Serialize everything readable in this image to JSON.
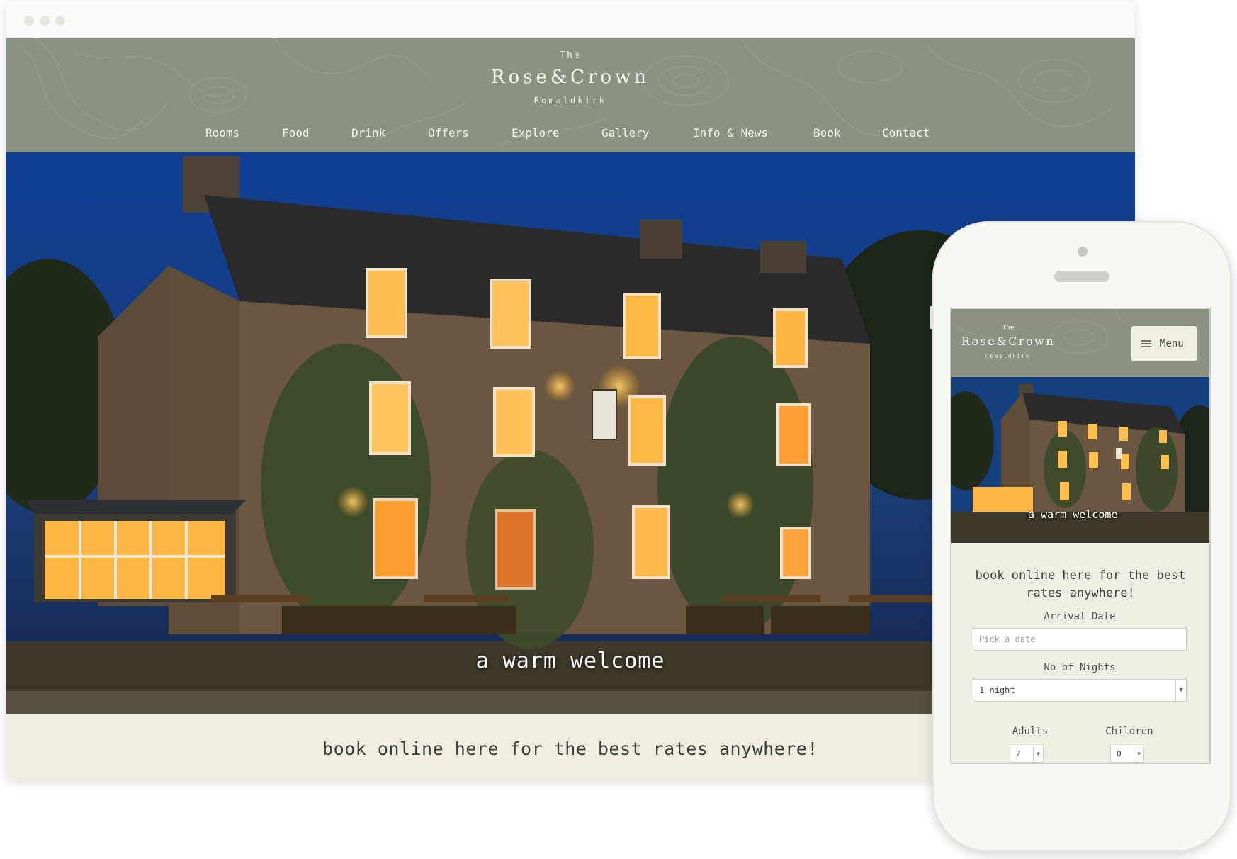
{
  "site": {
    "the": "The",
    "name": "Rose&Crown",
    "place": "Romaldkirk"
  },
  "nav": {
    "items": [
      {
        "label": "Rooms"
      },
      {
        "label": "Food"
      },
      {
        "label": "Drink"
      },
      {
        "label": "Offers"
      },
      {
        "label": "Explore"
      },
      {
        "label": "Gallery"
      },
      {
        "label": "Info & News"
      },
      {
        "label": "Book"
      },
      {
        "label": "Contact"
      }
    ]
  },
  "hero": {
    "caption": "a warm welcome"
  },
  "booking": {
    "headline": "book online here for the best rates anywhere!"
  },
  "mobile": {
    "the": "The",
    "name": "Rose&Crown",
    "place": "Romaldkirk",
    "menu_label": "Menu",
    "menu_icon": "hamburger-icon",
    "hero_caption": "a warm welcome",
    "book_line1": "book online here for the best",
    "book_line2": "rates anywhere!",
    "arrival_label": "Arrival Date",
    "arrival_placeholder": "Pick a date",
    "nights_label": "No of Nights",
    "nights_value": "1 night",
    "adults_label": "Adults",
    "adults_value": "2",
    "children_label": "Children",
    "children_value": "0"
  },
  "colors": {
    "header_bg": "#8a9282",
    "cream": "#efeee1",
    "sky": "#1c3d7a"
  }
}
